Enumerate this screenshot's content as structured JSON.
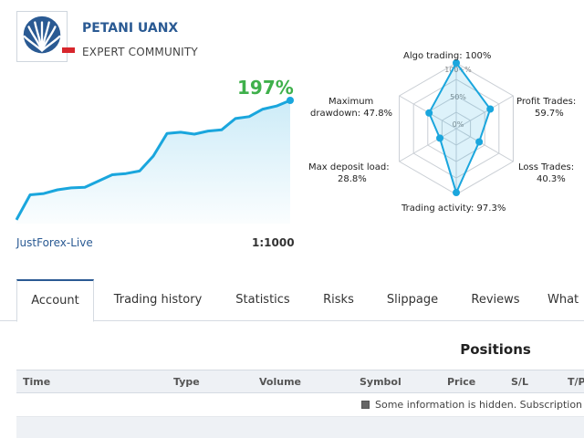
{
  "profile": {
    "name": "PETANI UANX",
    "subtitle": "EXPERT COMMUNITY"
  },
  "account": {
    "growth": "197%",
    "broker": "JustForex-Live",
    "leverage": "1:1000"
  },
  "radar": {
    "algo_trading": "Algo trading: 100%",
    "profit_trades_label": "Profit Trades:",
    "profit_trades_value": "59.7%",
    "loss_trades_label": "Loss Trades:",
    "loss_trades_value": "40.3%",
    "trading_activity": "Trading activity: 97.3%",
    "max_deposit_load_label": "Max deposit load:",
    "max_deposit_load_value": "28.8%",
    "max_drawdown_label": "Maximum",
    "max_drawdown_value": "drawdown: 47.8%",
    "ring_100": "100+%",
    "ring_50": "50%",
    "ring_0": "0%",
    "values": {
      "algo": 1.0,
      "profit": 0.597,
      "loss": 0.403,
      "activity": 0.973,
      "deposit": 0.288,
      "drawdown": 0.478
    },
    "color": "#1aa6dd"
  },
  "tabs": [
    "Account",
    "Trading history",
    "Statistics",
    "Risks",
    "Slippage",
    "Reviews",
    "What"
  ],
  "positions": {
    "title": "Positions",
    "columns": [
      "Time",
      "Type",
      "Volume",
      "Symbol",
      "Price",
      "S/L",
      "T/P"
    ],
    "hidden_message": "Some information is hidden. Subscription"
  },
  "colors": {
    "accent": "#2a5a93",
    "growth": "#3fb04b",
    "chart_line": "#1aa6dd"
  },
  "chart_data": {
    "type": "area",
    "title": "",
    "values": [
      6,
      46,
      48,
      54,
      57,
      58,
      68,
      78,
      80,
      84,
      108,
      144,
      146,
      143,
      148,
      150,
      168,
      171,
      183,
      188,
      197
    ]
  }
}
